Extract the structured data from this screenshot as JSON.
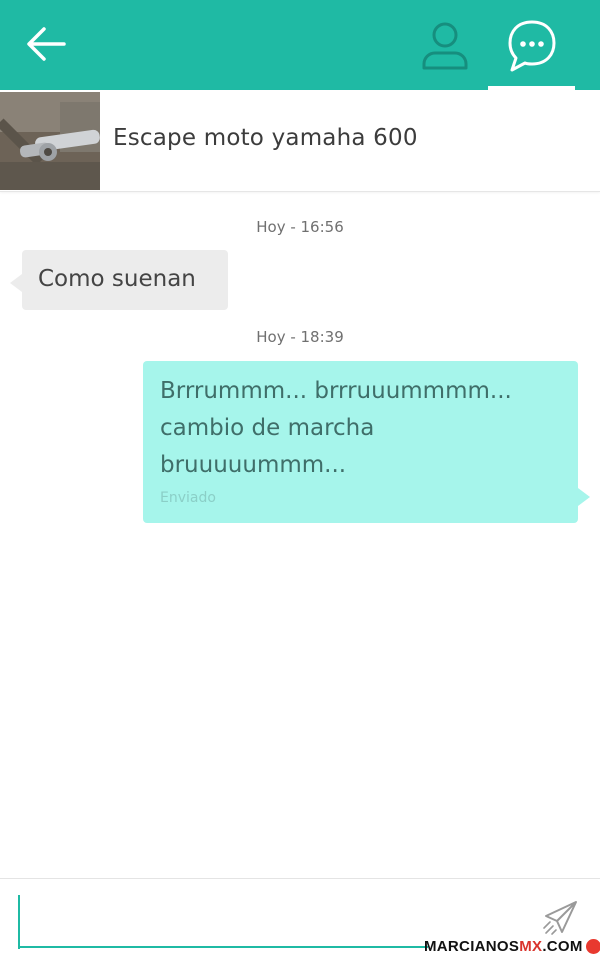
{
  "colors": {
    "primary": "#1fbaa4",
    "outgoing_bubble": "#a6f5eb",
    "incoming_bubble": "#ececec"
  },
  "header": {
    "back_icon": "arrow-left-icon",
    "profile_icon": "user-icon",
    "chat_icon": "chat-bubble-icon",
    "active_tab": "chat"
  },
  "product": {
    "title": "Escape moto yamaha 600",
    "thumbnail_icon": "exhaust-pipe-photo"
  },
  "messages": [
    {
      "timestamp": "Hoy - 16:56",
      "direction": "incoming",
      "text": "Como suenan"
    },
    {
      "timestamp": "Hoy - 18:39",
      "direction": "outgoing",
      "text": "Brrrummm... brrruuummmm...\ncambio de marcha\nbruuuuummm...",
      "status": "Enviado"
    }
  ],
  "composer": {
    "value": "",
    "send_icon": "paper-plane-icon"
  },
  "watermark": {
    "prefix": "MARCIANOS",
    "middle": "MX",
    "suffix": ".COM"
  }
}
